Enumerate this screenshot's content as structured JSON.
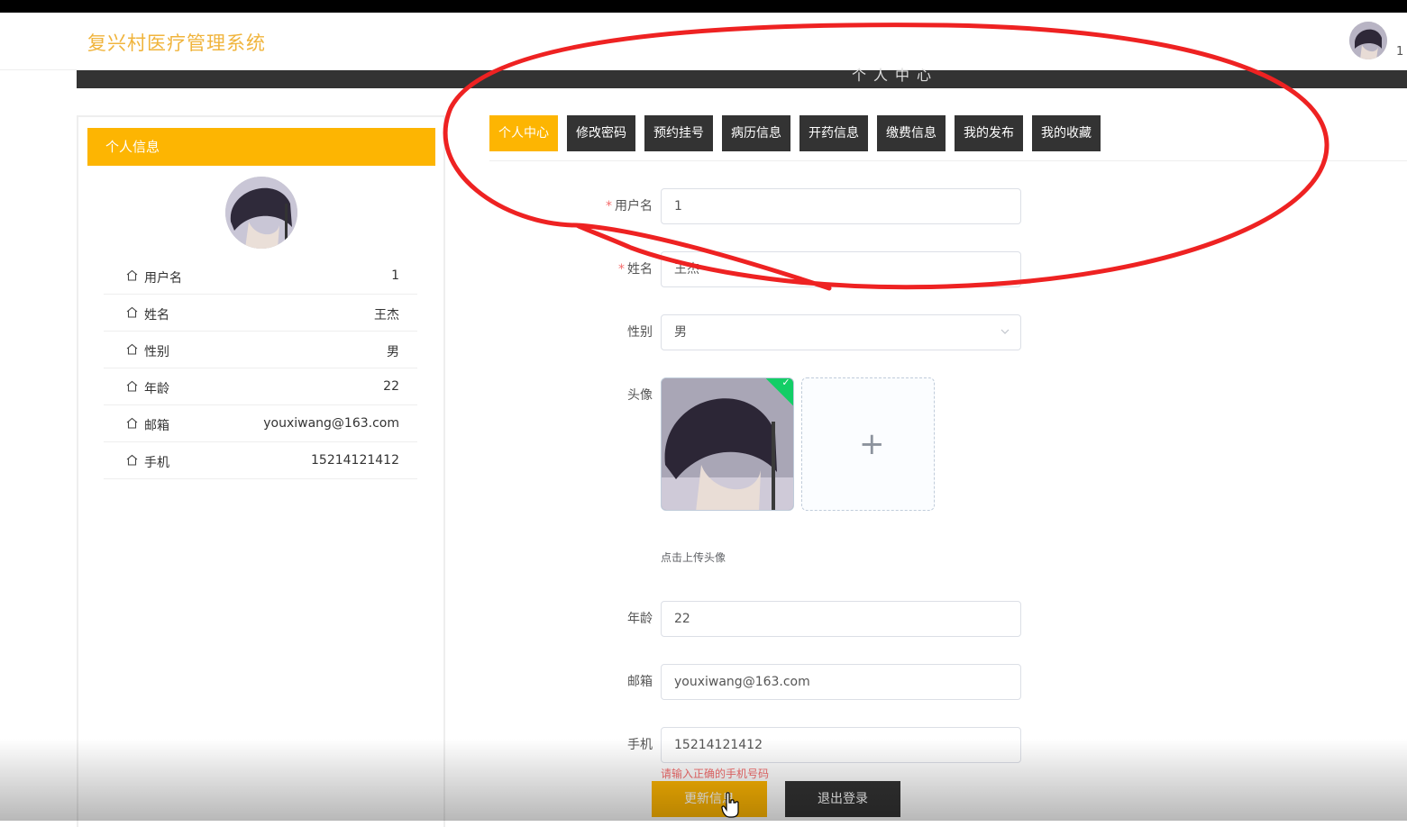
{
  "header": {
    "brand": "复兴村医疗管理系统",
    "username": "1",
    "banner_title": "个人中心"
  },
  "sidebar": {
    "title": "个人信息",
    "items": [
      {
        "label": "用户名",
        "value": "1",
        "icon": "home-icon"
      },
      {
        "label": "姓名",
        "value": "王杰",
        "icon": "home-icon"
      },
      {
        "label": "性别",
        "value": "男",
        "icon": "home-icon"
      },
      {
        "label": "年龄",
        "value": "22",
        "icon": "home-icon"
      },
      {
        "label": "邮箱",
        "value": "youxiwang@163.com",
        "icon": "home-icon"
      },
      {
        "label": "手机",
        "value": "15214121412",
        "icon": "home-icon"
      }
    ]
  },
  "tabs": [
    {
      "label": "个人中心",
      "active": true
    },
    {
      "label": "修改密码",
      "active": false
    },
    {
      "label": "预约挂号",
      "active": false
    },
    {
      "label": "病历信息",
      "active": false
    },
    {
      "label": "开药信息",
      "active": false
    },
    {
      "label": "缴费信息",
      "active": false
    },
    {
      "label": "我的发布",
      "active": false
    },
    {
      "label": "我的收藏",
      "active": false
    }
  ],
  "form": {
    "required_mark": "*",
    "username": {
      "label": "用户名",
      "value": "1"
    },
    "name": {
      "label": "姓名",
      "value": "王杰"
    },
    "gender": {
      "label": "性别",
      "value": "男"
    },
    "avatar": {
      "label": "头像",
      "tip": "点击上传头像",
      "add_symbol": "+"
    },
    "age": {
      "label": "年龄",
      "value": "22"
    },
    "email": {
      "label": "邮箱",
      "value": "youxiwang@163.com"
    },
    "phone": {
      "label": "手机",
      "value": "15214121412",
      "error": "请输入正确的手机号码"
    }
  },
  "buttons": {
    "update": "更新信息",
    "logout": "退出登录"
  },
  "colors": {
    "accent": "#fdb502",
    "brand_text": "#f0b43c",
    "dark": "#333333",
    "annotation": "#ee2222",
    "success": "#13ce66",
    "error": "#f56c6c"
  }
}
